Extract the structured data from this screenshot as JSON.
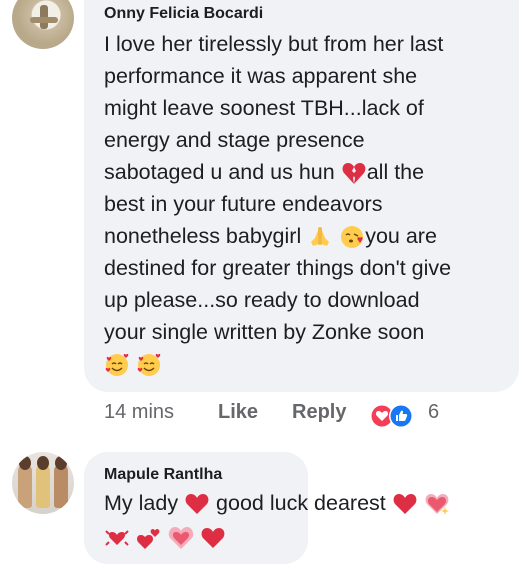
{
  "comments": [
    {
      "author": "Onny Felicia Bocardi",
      "lines": [
        "I love her tirelessly but from her last",
        "performance it was apparent she",
        "might leave soonest TBH...lack of",
        "energy and stage presence",
        "sabotaged u and us hun",
        "all the",
        "best in your future endeavors",
        "nonetheless babygirl",
        "you are",
        "destined for greater things don't give",
        "up please...so ready to download",
        "your single written by Zonke soon"
      ],
      "emojis": [
        "broken-heart",
        "folded-hands",
        "face-blowing-kiss",
        "smiling-face-with-hearts",
        "smiling-face-with-hearts"
      ],
      "time": "14 mins",
      "like_label": "Like",
      "reply_label": "Reply",
      "reaction_types": [
        "love",
        "like"
      ],
      "reaction_count": "6"
    },
    {
      "author": "Mapule Rantlha",
      "line1_a": "My lady",
      "line1_b": "good  luck dearest",
      "emojis": [
        "red-heart",
        "red-heart",
        "sparkling-heart",
        "beating-heart",
        "two-hearts",
        "growing-heart",
        "red-heart"
      ]
    }
  ],
  "colors": {
    "bubble": "#f0f2f5",
    "text": "#1c1e21",
    "meta": "#65676b",
    "like_blue": "#1877f2",
    "love_red": "#f33e58"
  }
}
